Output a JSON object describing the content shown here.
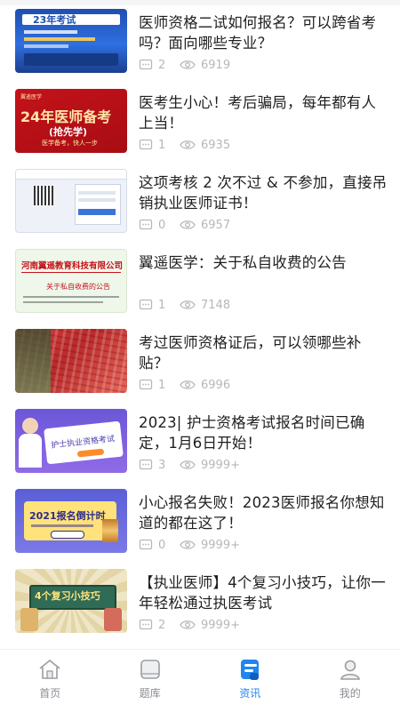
{
  "articles": [
    {
      "title": "医师资格二试如何报名？可以跨省考吗？面向哪些专业？",
      "comments": "2",
      "views": "6919",
      "thumb": {
        "kind": "blue-flyer",
        "caption": "23年考试"
      }
    },
    {
      "title": "医考生小心！考后骗局，每年都有人上当！",
      "comments": "1",
      "views": "6935",
      "thumb": {
        "kind": "red-banner",
        "headline": "24年医师备考",
        "sub": "(抢先学)",
        "slogan": "医学备考，快人一步",
        "brand": "翼遥医学"
      }
    },
    {
      "title": "这项考核 2 次不过 & 不参加，直接吊销执业医师证书！",
      "comments": "0",
      "views": "6957",
      "thumb": {
        "kind": "web-screenshot"
      }
    },
    {
      "title": "翼遥医学：关于私自收费的公告",
      "comments": "1",
      "views": "7148",
      "thumb": {
        "kind": "notice",
        "company": "河南翼遥教育科技有限公司",
        "notice": "关于私自收费的公告"
      }
    },
    {
      "title": "考过医师资格证后，可以领哪些补贴？",
      "comments": "1",
      "views": "6996",
      "thumb": {
        "kind": "money-photo"
      }
    },
    {
      "title": "2023| 护士资格考试报名时间已确定，1月6日开始！",
      "comments": "3",
      "views": "9999+",
      "thumb": {
        "kind": "nurse",
        "caption": "护士执业资格考试"
      }
    },
    {
      "title": "小心报名失败！2023医师报名你想知道的都在这了！",
      "comments": "0",
      "views": "9999+",
      "thumb": {
        "kind": "countdown",
        "caption": "2021报名倒计时"
      }
    },
    {
      "title": "【执业医师】4个复习小技巧，让你一年轻松通过执医考试",
      "comments": "2",
      "views": "9999+",
      "thumb": {
        "kind": "tips",
        "caption": "4个复习小技巧"
      }
    }
  ],
  "tabs": [
    {
      "label": "首页",
      "icon": "home-icon",
      "active": false
    },
    {
      "label": "题库",
      "icon": "question-bank-icon",
      "active": false
    },
    {
      "label": "资讯",
      "icon": "news-icon",
      "active": true
    },
    {
      "label": "我的",
      "icon": "profile-icon",
      "active": false
    }
  ],
  "colors": {
    "accent": "#1f86f0",
    "meta": "#b4b7bd",
    "title": "#1f1f1f"
  }
}
